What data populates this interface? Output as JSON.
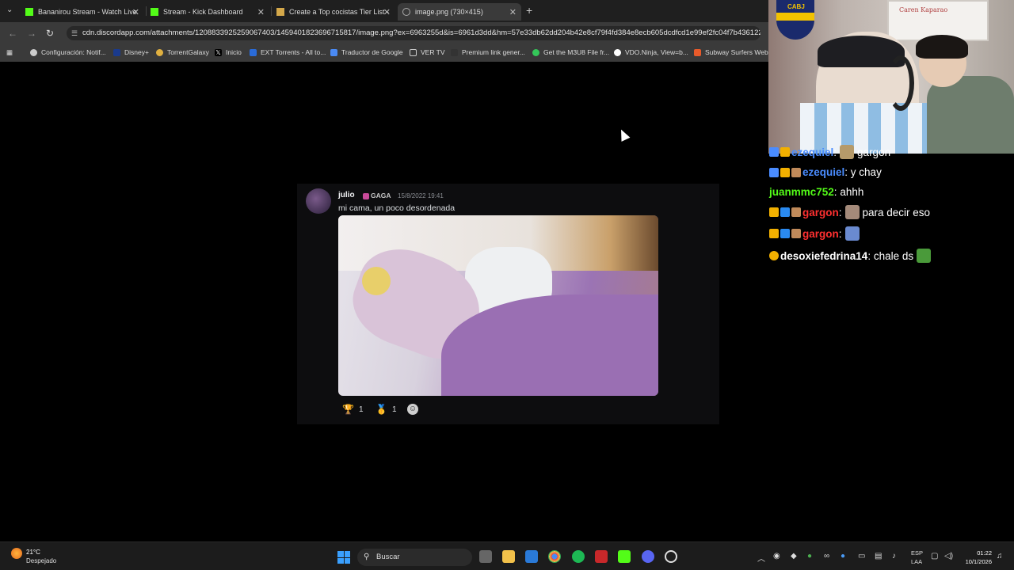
{
  "browser": {
    "tabs": [
      {
        "title": "Bananirou Stream - Watch Live",
        "icon": "kick-icon",
        "color": "#53fc18"
      },
      {
        "title": "Stream - Kick Dashboard",
        "icon": "kick-icon",
        "color": "#53fc18"
      },
      {
        "title": "Create a Top cocistas Tier List -",
        "icon": "tiermaker-icon",
        "color": "#d4a84a"
      },
      {
        "title": "image.png (730×415)",
        "icon": "globe-icon",
        "color": "#aaaaaa",
        "active": true
      }
    ],
    "url": "cdn.discordapp.com/attachments/1208833925259067403/1459401823696715817/image.png?ex=6963255d&is=6961d3dd&hm=57e33db62dd204b42e8cf79f4fd384e8ecb605dcdfcd1e99ef2fc04f7b436122&",
    "bookmarks": [
      {
        "label": "Configuración: Notif...",
        "icon": "gear-icon",
        "color": "#cccccc"
      },
      {
        "label": "Disney+",
        "icon": "disney-icon",
        "color": "#1a3a8c"
      },
      {
        "label": "TorrentGalaxy",
        "icon": "torrentgalaxy-icon",
        "color": "#e0b040"
      },
      {
        "label": "Inicio",
        "icon": "x-icon",
        "color": "#ffffff"
      },
      {
        "label": "EXT Torrents - All to...",
        "icon": "ext-icon",
        "color": "#2a6bd8"
      },
      {
        "label": "Traductor de Google",
        "icon": "translate-icon",
        "color": "#4a8af4"
      },
      {
        "label": "VER TV",
        "icon": "folder-icon",
        "color": "#cccccc"
      },
      {
        "label": "Premium link gener...",
        "icon": "link-icon",
        "color": "#333333"
      },
      {
        "label": "Get the M3U8 File fr...",
        "icon": "m3u8-icon",
        "color": "#34c759"
      },
      {
        "label": "VDO.Ninja, View=b...",
        "icon": "vdoninja-icon",
        "color": "#ffffff"
      },
      {
        "label": "Subway Surfers Web",
        "icon": "subway-icon",
        "color": "#e85a2a"
      }
    ]
  },
  "discord": {
    "username": "julio",
    "tag": "GAGA",
    "timestamp": "15/8/2022 19:41",
    "message": "mi cama, un poco desordenada",
    "reactions": [
      {
        "emoji": "🏆",
        "count": "1"
      },
      {
        "emoji": "🥇",
        "count": "1"
      }
    ]
  },
  "webcam": {
    "flag_text": "CABJ",
    "whiteboard_text": "Caren Kaparao"
  },
  "chat": {
    "messages": [
      {
        "user": "ezequiel",
        "text": "gargon",
        "user_color": "#4a8cff",
        "partial": true
      },
      {
        "user": "ezequiel",
        "text": "y chay",
        "user_color": "#4a8cff"
      },
      {
        "user": "juanmmc752",
        "text": "ahhh",
        "user_color": "#53fc18"
      },
      {
        "user": "gargon",
        "text": "para decir eso",
        "user_color": "#ff3030"
      },
      {
        "user": "gargon",
        "text": "",
        "user_color": "#ff3030"
      },
      {
        "user": "desoxiefedrina14",
        "text": "chale ds",
        "user_color": "#ffffff"
      }
    ]
  },
  "taskbar": {
    "temperature": "21°C",
    "weather": "Despejado",
    "search_placeholder": "Buscar",
    "lang_line1": "ESP",
    "lang_line2": "LAA",
    "time": "01:22",
    "date": "10/1/2026"
  }
}
